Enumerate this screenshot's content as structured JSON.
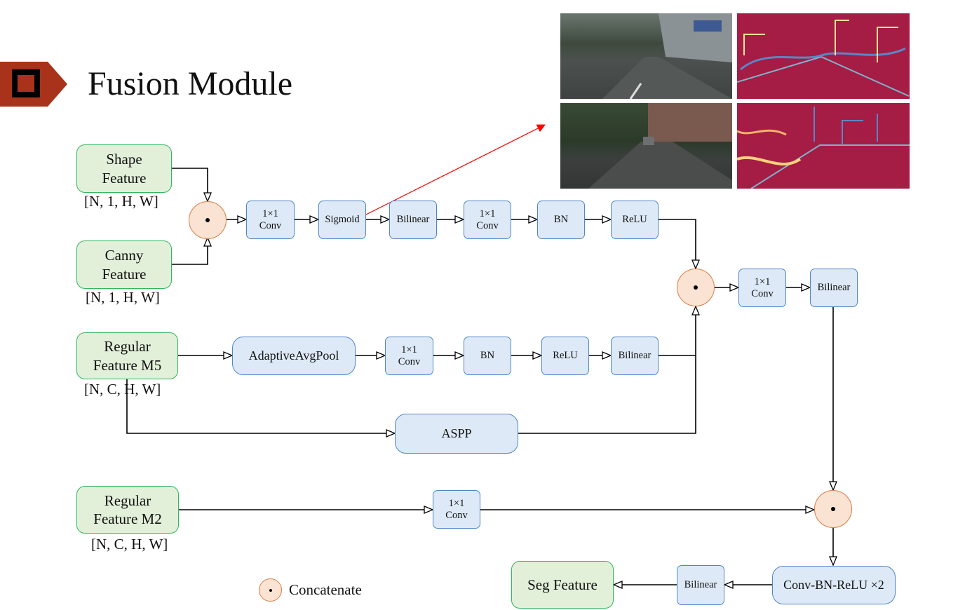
{
  "title": "Fusion Module",
  "colors": {
    "title_banner": "#a9321a",
    "op_fill": "#dde9f6",
    "op_border": "#4f86c6",
    "feature_fill": "#e2efd9",
    "feature_border": "#2fb75c",
    "concat_fill": "#fbe3d3",
    "concat_border": "#d87c43",
    "highlight_arrow": "#ff0000"
  },
  "inputs": {
    "shape": {
      "label_line1": "Shape",
      "label_line2": "Feature",
      "dims": "[N, 1, H, W]"
    },
    "canny": {
      "label_line1": "Canny",
      "label_line2": "Feature",
      "dims": "[N, 1, H, W]"
    },
    "m5": {
      "label_line1": "Regular",
      "label_line2": "Feature M5",
      "dims": "[N, C, H, W]"
    },
    "m2": {
      "label_line1": "Regular",
      "label_line2": "Feature M2",
      "dims": "[N, C, H, W]"
    }
  },
  "shape_branch": {
    "conv_a_line1": "1×1",
    "conv_a_line2": "Conv",
    "sigmoid": "Sigmoid",
    "bilinear": "Bilinear",
    "conv_b_line1": "1×1",
    "conv_b_line2": "Conv",
    "bn": "BN",
    "relu": "ReLU"
  },
  "m5_branch": {
    "pool": "AdaptiveAvgPool",
    "conv_line1": "1×1",
    "conv_line2": "Conv",
    "bn": "BN",
    "relu": "ReLU",
    "bilinear": "Bilinear",
    "aspp": "ASPP"
  },
  "merge_branch": {
    "conv_line1": "1×1",
    "conv_line2": "Conv",
    "bilinear": "Bilinear"
  },
  "m2_branch": {
    "conv_line1": "1×1",
    "conv_line2": "Conv"
  },
  "output_branch": {
    "conv_bn_relu": "Conv-BN-ReLU ×2",
    "bilinear": "Bilinear",
    "seg_feature": "Seg Feature"
  },
  "legend": {
    "concat_label": "Concatenate"
  },
  "visualization": {
    "panels": [
      {
        "kind": "street-photo",
        "row": 1
      },
      {
        "kind": "attention-heatmap",
        "row": 1
      },
      {
        "kind": "street-photo",
        "row": 2
      },
      {
        "kind": "attention-heatmap",
        "row": 2
      }
    ]
  }
}
